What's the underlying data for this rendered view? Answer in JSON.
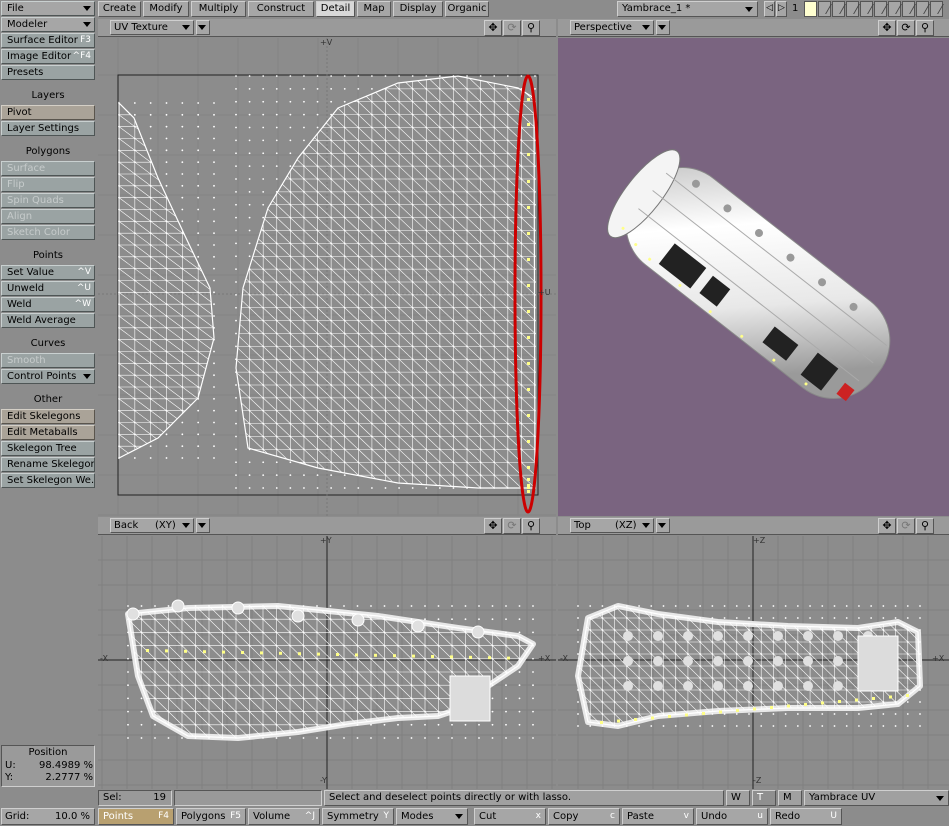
{
  "sidebar": {
    "top": [
      {
        "label": "File"
      },
      {
        "label": "Modeler"
      }
    ],
    "groups": [
      {
        "items": [
          {
            "label": "Surface Editor",
            "shortcut": "F3"
          },
          {
            "label": "Image Editor",
            "shortcut": "^F4"
          },
          {
            "label": "Presets",
            "shortcut": ""
          }
        ]
      },
      {
        "header": "Layers",
        "items": [
          {
            "label": "Pivot",
            "shortcut": ""
          },
          {
            "label": "Layer Settings",
            "shortcut": ""
          }
        ]
      },
      {
        "header": "Polygons",
        "items": [
          {
            "label": "Surface",
            "shortcut": ""
          },
          {
            "label": "Flip",
            "shortcut": ""
          },
          {
            "label": "Spin Quads",
            "shortcut": ""
          },
          {
            "label": "Align",
            "shortcut": ""
          },
          {
            "label": "Sketch Color",
            "shortcut": ""
          }
        ]
      },
      {
        "header": "Points",
        "items": [
          {
            "label": "Set Value",
            "shortcut": "^V"
          },
          {
            "label": "Unweld",
            "shortcut": "^U"
          },
          {
            "label": "Weld",
            "shortcut": "^W"
          },
          {
            "label": "Weld Average",
            "shortcut": ""
          }
        ]
      },
      {
        "header": "Curves",
        "items": [
          {
            "label": "Smooth",
            "shortcut": ""
          },
          {
            "label": "Control Points",
            "shortcut": ""
          }
        ]
      },
      {
        "header": "Other",
        "items": [
          {
            "label": "Edit Skelegons",
            "shortcut": ""
          },
          {
            "label": "Edit Metaballs",
            "shortcut": ""
          },
          {
            "label": "Skelegon Tree",
            "shortcut": ""
          },
          {
            "label": "Rename Skelegon",
            "shortcut": ""
          },
          {
            "label": "Set Skelegon We…",
            "shortcut": ""
          }
        ]
      }
    ],
    "position": {
      "title": "Position",
      "u_label": "U:",
      "u_value": "98.4989 %",
      "v_label": "Y:",
      "v_value": "2.2777 %"
    },
    "grid": {
      "label": "Grid:",
      "value": "10.0 %"
    }
  },
  "tabs": [
    "Create",
    "Modify",
    "Multiply",
    "Construct",
    "Detail",
    "Map",
    "Display",
    "Organic"
  ],
  "active_tab": "Detail",
  "object": {
    "name": "Yambrace_1 *",
    "layer_number": "1"
  },
  "viewports": {
    "uv": {
      "label": "UV Texture",
      "axis_v": "+V",
      "axis_u": "+U"
    },
    "perspective": {
      "label": "Perspective",
      "bg": "#7a6480"
    },
    "back": {
      "label": "Back",
      "plane": "(XY)",
      "axis_top": "+Y",
      "axis_bottom": "-Y",
      "axis_left": "-X",
      "axis_right": "+X"
    },
    "top": {
      "label": "Top",
      "plane": "(XZ)",
      "axis_top": "+Z",
      "axis_bottom": "-Z",
      "axis_left": "-X",
      "axis_right": "+X"
    }
  },
  "status": {
    "sel_label": "Sel:",
    "sel_value": "19",
    "message": "Select and deselect points directly or with lasso.",
    "w": "W",
    "t": "T",
    "m": "M",
    "uv_map": "Yambrace UV"
  },
  "bottom": [
    {
      "label": "Points",
      "shortcut": "F4"
    },
    {
      "label": "Polygons",
      "shortcut": "F5"
    },
    {
      "label": "Volume",
      "shortcut": "^J"
    },
    {
      "label": "Symmetry",
      "shortcut": "Y"
    },
    {
      "label": "Modes",
      "shortcut": ""
    },
    {
      "label": "Cut",
      "shortcut": "x"
    },
    {
      "label": "Copy",
      "shortcut": "c"
    },
    {
      "label": "Paste",
      "shortcut": "v"
    },
    {
      "label": "Undo",
      "shortcut": "u"
    },
    {
      "label": "Redo",
      "shortcut": "U"
    }
  ],
  "colors": {
    "highlight": "#cc0000",
    "selected_point": "#ffff88",
    "wire": "#ffffff"
  }
}
